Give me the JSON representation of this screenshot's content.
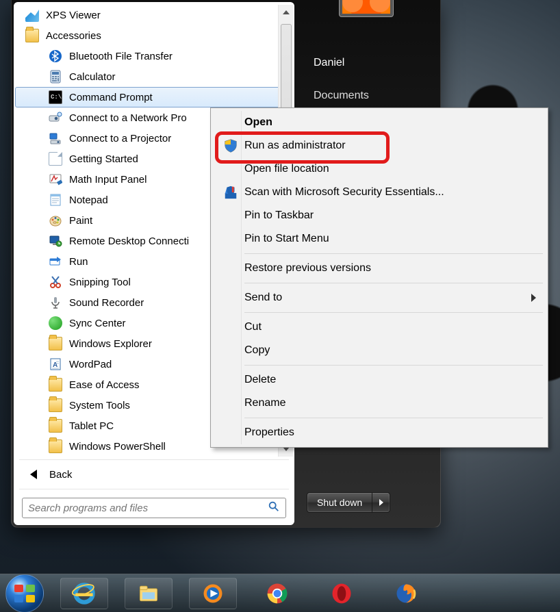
{
  "programs": {
    "top": [
      {
        "label": "XPS Viewer",
        "icon": "xps"
      },
      {
        "label": "Accessories",
        "icon": "folder"
      }
    ],
    "accessories": [
      {
        "label": "Bluetooth File Transfer",
        "icon": "bluetooth"
      },
      {
        "label": "Calculator",
        "icon": "calculator"
      },
      {
        "label": "Command Prompt",
        "icon": "cmd",
        "selected": true
      },
      {
        "label": "Connect to a Network Pro",
        "icon": "netproj"
      },
      {
        "label": "Connect to a Projector",
        "icon": "projector"
      },
      {
        "label": "Getting Started",
        "icon": "gettingstarted"
      },
      {
        "label": "Math Input Panel",
        "icon": "mathinput"
      },
      {
        "label": "Notepad",
        "icon": "notepad"
      },
      {
        "label": "Paint",
        "icon": "paint"
      },
      {
        "label": "Remote Desktop Connecti",
        "icon": "rdp"
      },
      {
        "label": "Run",
        "icon": "run"
      },
      {
        "label": "Snipping Tool",
        "icon": "snip"
      },
      {
        "label": "Sound Recorder",
        "icon": "mic"
      },
      {
        "label": "Sync Center",
        "icon": "sync"
      },
      {
        "label": "Windows Explorer",
        "icon": "explorer"
      },
      {
        "label": "WordPad",
        "icon": "wordpad"
      }
    ],
    "subfolders": [
      {
        "label": "Ease of Access",
        "icon": "folder"
      },
      {
        "label": "System Tools",
        "icon": "folder"
      },
      {
        "label": "Tablet PC",
        "icon": "folder"
      },
      {
        "label": "Windows PowerShell",
        "icon": "folder"
      }
    ],
    "back_label": "Back",
    "search_placeholder": "Search programs and files"
  },
  "right_panel": {
    "user_name": "Daniel",
    "documents_label": "Documents",
    "shutdown_label": "Shut down"
  },
  "context_menu": {
    "groups": [
      [
        {
          "label": "Open",
          "bold": true
        },
        {
          "label": "Run as administrator",
          "icon": "shield",
          "highlighted": true
        },
        {
          "label": "Open file location"
        },
        {
          "label": "Scan with Microsoft Security Essentials...",
          "icon": "mse"
        },
        {
          "label": "Pin to Taskbar"
        },
        {
          "label": "Pin to Start Menu"
        }
      ],
      [
        {
          "label": "Restore previous versions"
        }
      ],
      [
        {
          "label": "Send to",
          "submenu": true
        }
      ],
      [
        {
          "label": "Cut"
        },
        {
          "label": "Copy"
        }
      ],
      [
        {
          "label": "Delete"
        },
        {
          "label": "Rename"
        }
      ],
      [
        {
          "label": "Properties"
        }
      ]
    ]
  },
  "taskbar": {
    "items": [
      "start",
      "ie",
      "explorer",
      "wmp",
      "chrome",
      "opera",
      "firefox"
    ]
  }
}
